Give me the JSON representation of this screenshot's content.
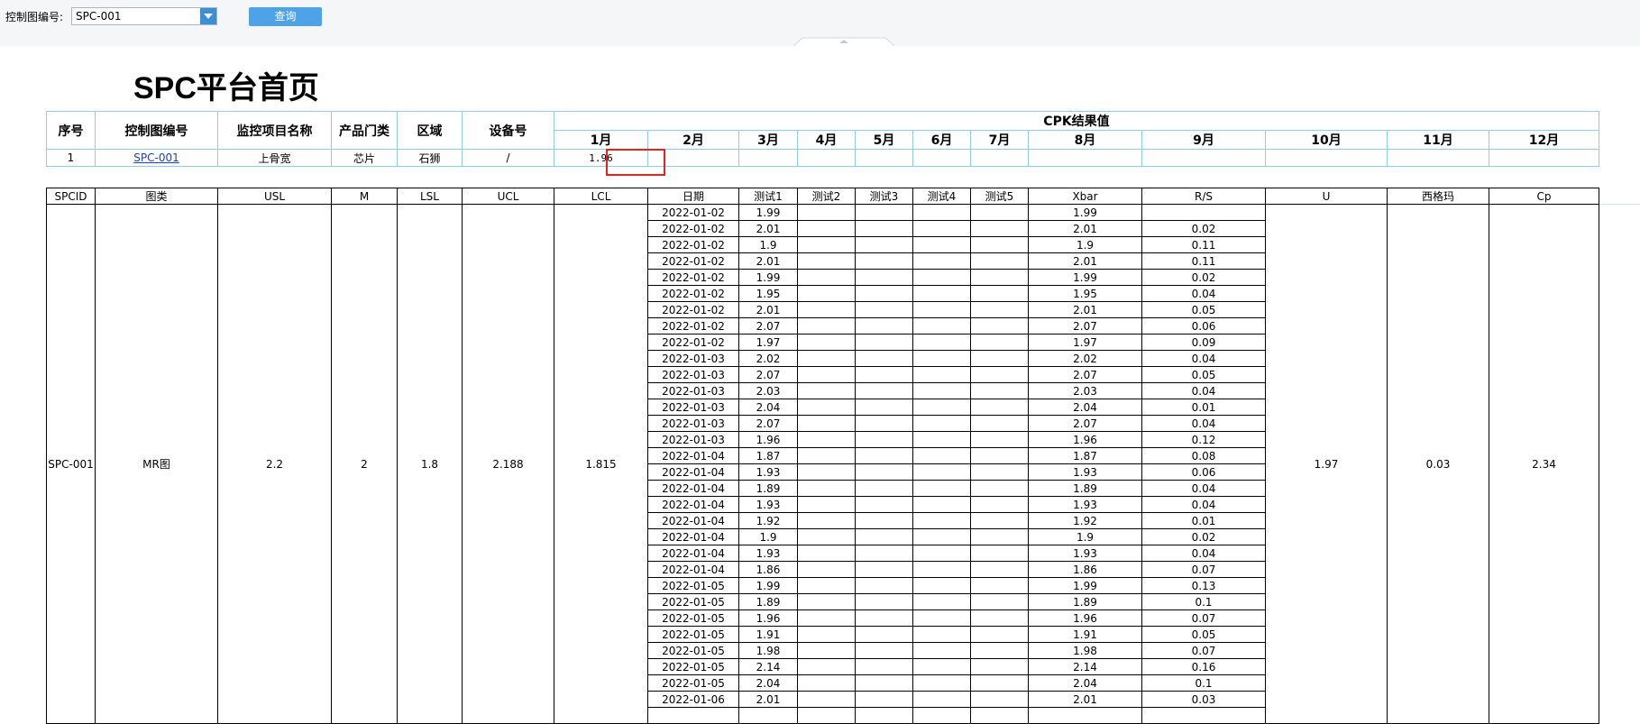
{
  "toolbar": {
    "label": "控制图编号:",
    "select_value": "SPC-001",
    "query_label": "查询"
  },
  "page_title": "SPC平台首页",
  "summary": {
    "headers": [
      "序号",
      "控制图编号",
      "监控项目名称",
      "产品门类",
      "区域",
      "设备号"
    ],
    "cpk_header": "CPK结果值",
    "months": [
      "1月",
      "2月",
      "3月",
      "4月",
      "5月",
      "6月",
      "7月",
      "8月",
      "9月",
      "10月",
      "11月",
      "12月"
    ],
    "row": {
      "seq": "1",
      "chart_no": "SPC-001",
      "item": "上骨宽",
      "category": "芯片",
      "area": "石狮",
      "device": "/",
      "cpk": [
        "1.96",
        "",
        "",
        "",
        "",
        "",
        "",
        "",
        "",
        "",
        "",
        ""
      ]
    }
  },
  "detail": {
    "headers": [
      "SPCID",
      "图类",
      "USL",
      "M",
      "LSL",
      "UCL",
      "LCL",
      "日期",
      "测试1",
      "测试2",
      "测试3",
      "测试4",
      "测试5",
      "Xbar",
      "R/S",
      "U",
      "西格玛",
      "Cp"
    ],
    "merged": {
      "spcid": "SPC-001",
      "chart_type": "MR图",
      "usl": "2.2",
      "m": "2",
      "lsl": "1.8",
      "ucl": "2.188",
      "lcl": "1.815",
      "u": "1.97",
      "sigma": "0.03",
      "cp": "2.34"
    },
    "rows": [
      {
        "date": "2022-01-02",
        "t1": "1.99",
        "xbar": "1.99",
        "rs": ""
      },
      {
        "date": "2022-01-02",
        "t1": "2.01",
        "xbar": "2.01",
        "rs": "0.02"
      },
      {
        "date": "2022-01-02",
        "t1": "1.9",
        "xbar": "1.9",
        "rs": "0.11"
      },
      {
        "date": "2022-01-02",
        "t1": "2.01",
        "xbar": "2.01",
        "rs": "0.11"
      },
      {
        "date": "2022-01-02",
        "t1": "1.99",
        "xbar": "1.99",
        "rs": "0.02"
      },
      {
        "date": "2022-01-02",
        "t1": "1.95",
        "xbar": "1.95",
        "rs": "0.04"
      },
      {
        "date": "2022-01-02",
        "t1": "2.01",
        "xbar": "2.01",
        "rs": "0.05"
      },
      {
        "date": "2022-01-02",
        "t1": "2.07",
        "xbar": "2.07",
        "rs": "0.06"
      },
      {
        "date": "2022-01-02",
        "t1": "1.97",
        "xbar": "1.97",
        "rs": "0.09"
      },
      {
        "date": "2022-01-03",
        "t1": "2.02",
        "xbar": "2.02",
        "rs": "0.04"
      },
      {
        "date": "2022-01-03",
        "t1": "2.07",
        "xbar": "2.07",
        "rs": "0.05"
      },
      {
        "date": "2022-01-03",
        "t1": "2.03",
        "xbar": "2.03",
        "rs": "0.04"
      },
      {
        "date": "2022-01-03",
        "t1": "2.04",
        "xbar": "2.04",
        "rs": "0.01"
      },
      {
        "date": "2022-01-03",
        "t1": "2.07",
        "xbar": "2.07",
        "rs": "0.04"
      },
      {
        "date": "2022-01-03",
        "t1": "1.96",
        "xbar": "1.96",
        "rs": "0.12"
      },
      {
        "date": "2022-01-04",
        "t1": "1.87",
        "xbar": "1.87",
        "rs": "0.08"
      },
      {
        "date": "2022-01-04",
        "t1": "1.93",
        "xbar": "1.93",
        "rs": "0.06"
      },
      {
        "date": "2022-01-04",
        "t1": "1.89",
        "xbar": "1.89",
        "rs": "0.04"
      },
      {
        "date": "2022-01-04",
        "t1": "1.93",
        "xbar": "1.93",
        "rs": "0.04"
      },
      {
        "date": "2022-01-04",
        "t1": "1.92",
        "xbar": "1.92",
        "rs": "0.01"
      },
      {
        "date": "2022-01-04",
        "t1": "1.9",
        "xbar": "1.9",
        "rs": "0.02"
      },
      {
        "date": "2022-01-04",
        "t1": "1.93",
        "xbar": "1.93",
        "rs": "0.04"
      },
      {
        "date": "2022-01-04",
        "t1": "1.86",
        "xbar": "1.86",
        "rs": "0.07"
      },
      {
        "date": "2022-01-05",
        "t1": "1.99",
        "xbar": "1.99",
        "rs": "0.13"
      },
      {
        "date": "2022-01-05",
        "t1": "1.89",
        "xbar": "1.89",
        "rs": "0.1"
      },
      {
        "date": "2022-01-05",
        "t1": "1.96",
        "xbar": "1.96",
        "rs": "0.07"
      },
      {
        "date": "2022-01-05",
        "t1": "1.91",
        "xbar": "1.91",
        "rs": "0.05"
      },
      {
        "date": "2022-01-05",
        "t1": "1.98",
        "xbar": "1.98",
        "rs": "0.07"
      },
      {
        "date": "2022-01-05",
        "t1": "2.14",
        "xbar": "2.14",
        "rs": "0.16"
      },
      {
        "date": "2022-01-05",
        "t1": "2.04",
        "xbar": "2.04",
        "rs": "0.1"
      },
      {
        "date": "2022-01-06",
        "t1": "2.01",
        "xbar": "2.01",
        "rs": "0.03"
      }
    ]
  }
}
